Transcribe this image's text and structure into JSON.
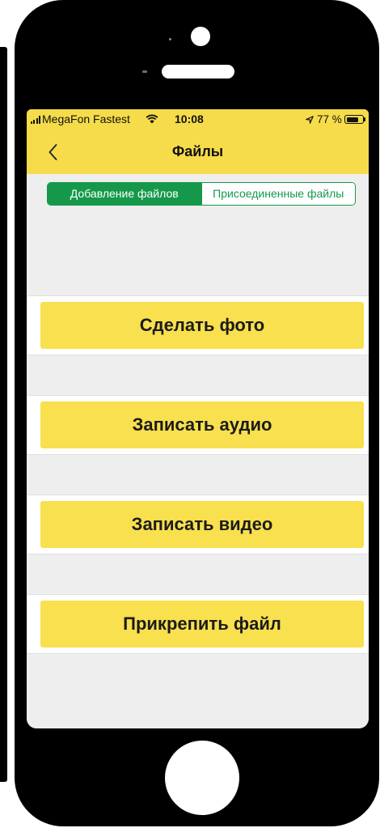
{
  "status_bar": {
    "carrier": "MegaFon Fastest",
    "time": "10:08",
    "battery_text": "77 %",
    "battery_level": 0.77
  },
  "nav": {
    "title": "Файлы"
  },
  "segments": [
    {
      "label": "Добавление файлов",
      "selected": true
    },
    {
      "label": "Присоединенные файлы",
      "selected": false
    }
  ],
  "actions": [
    {
      "label": "Сделать фото"
    },
    {
      "label": "Записать аудио"
    },
    {
      "label": "Записать видео"
    },
    {
      "label": "Прикрепить файл"
    }
  ],
  "icons": {
    "signal": "signal-bars-icon",
    "wifi": "wifi-icon",
    "location": "location-arrow-icon",
    "battery": "battery-icon",
    "back": "chevron-left-icon"
  },
  "colors": {
    "bar_yellow": "#F6DC4A",
    "button_yellow": "#F8E04E",
    "segment_green": "#16984B",
    "background_gray": "#EEEEEE"
  }
}
